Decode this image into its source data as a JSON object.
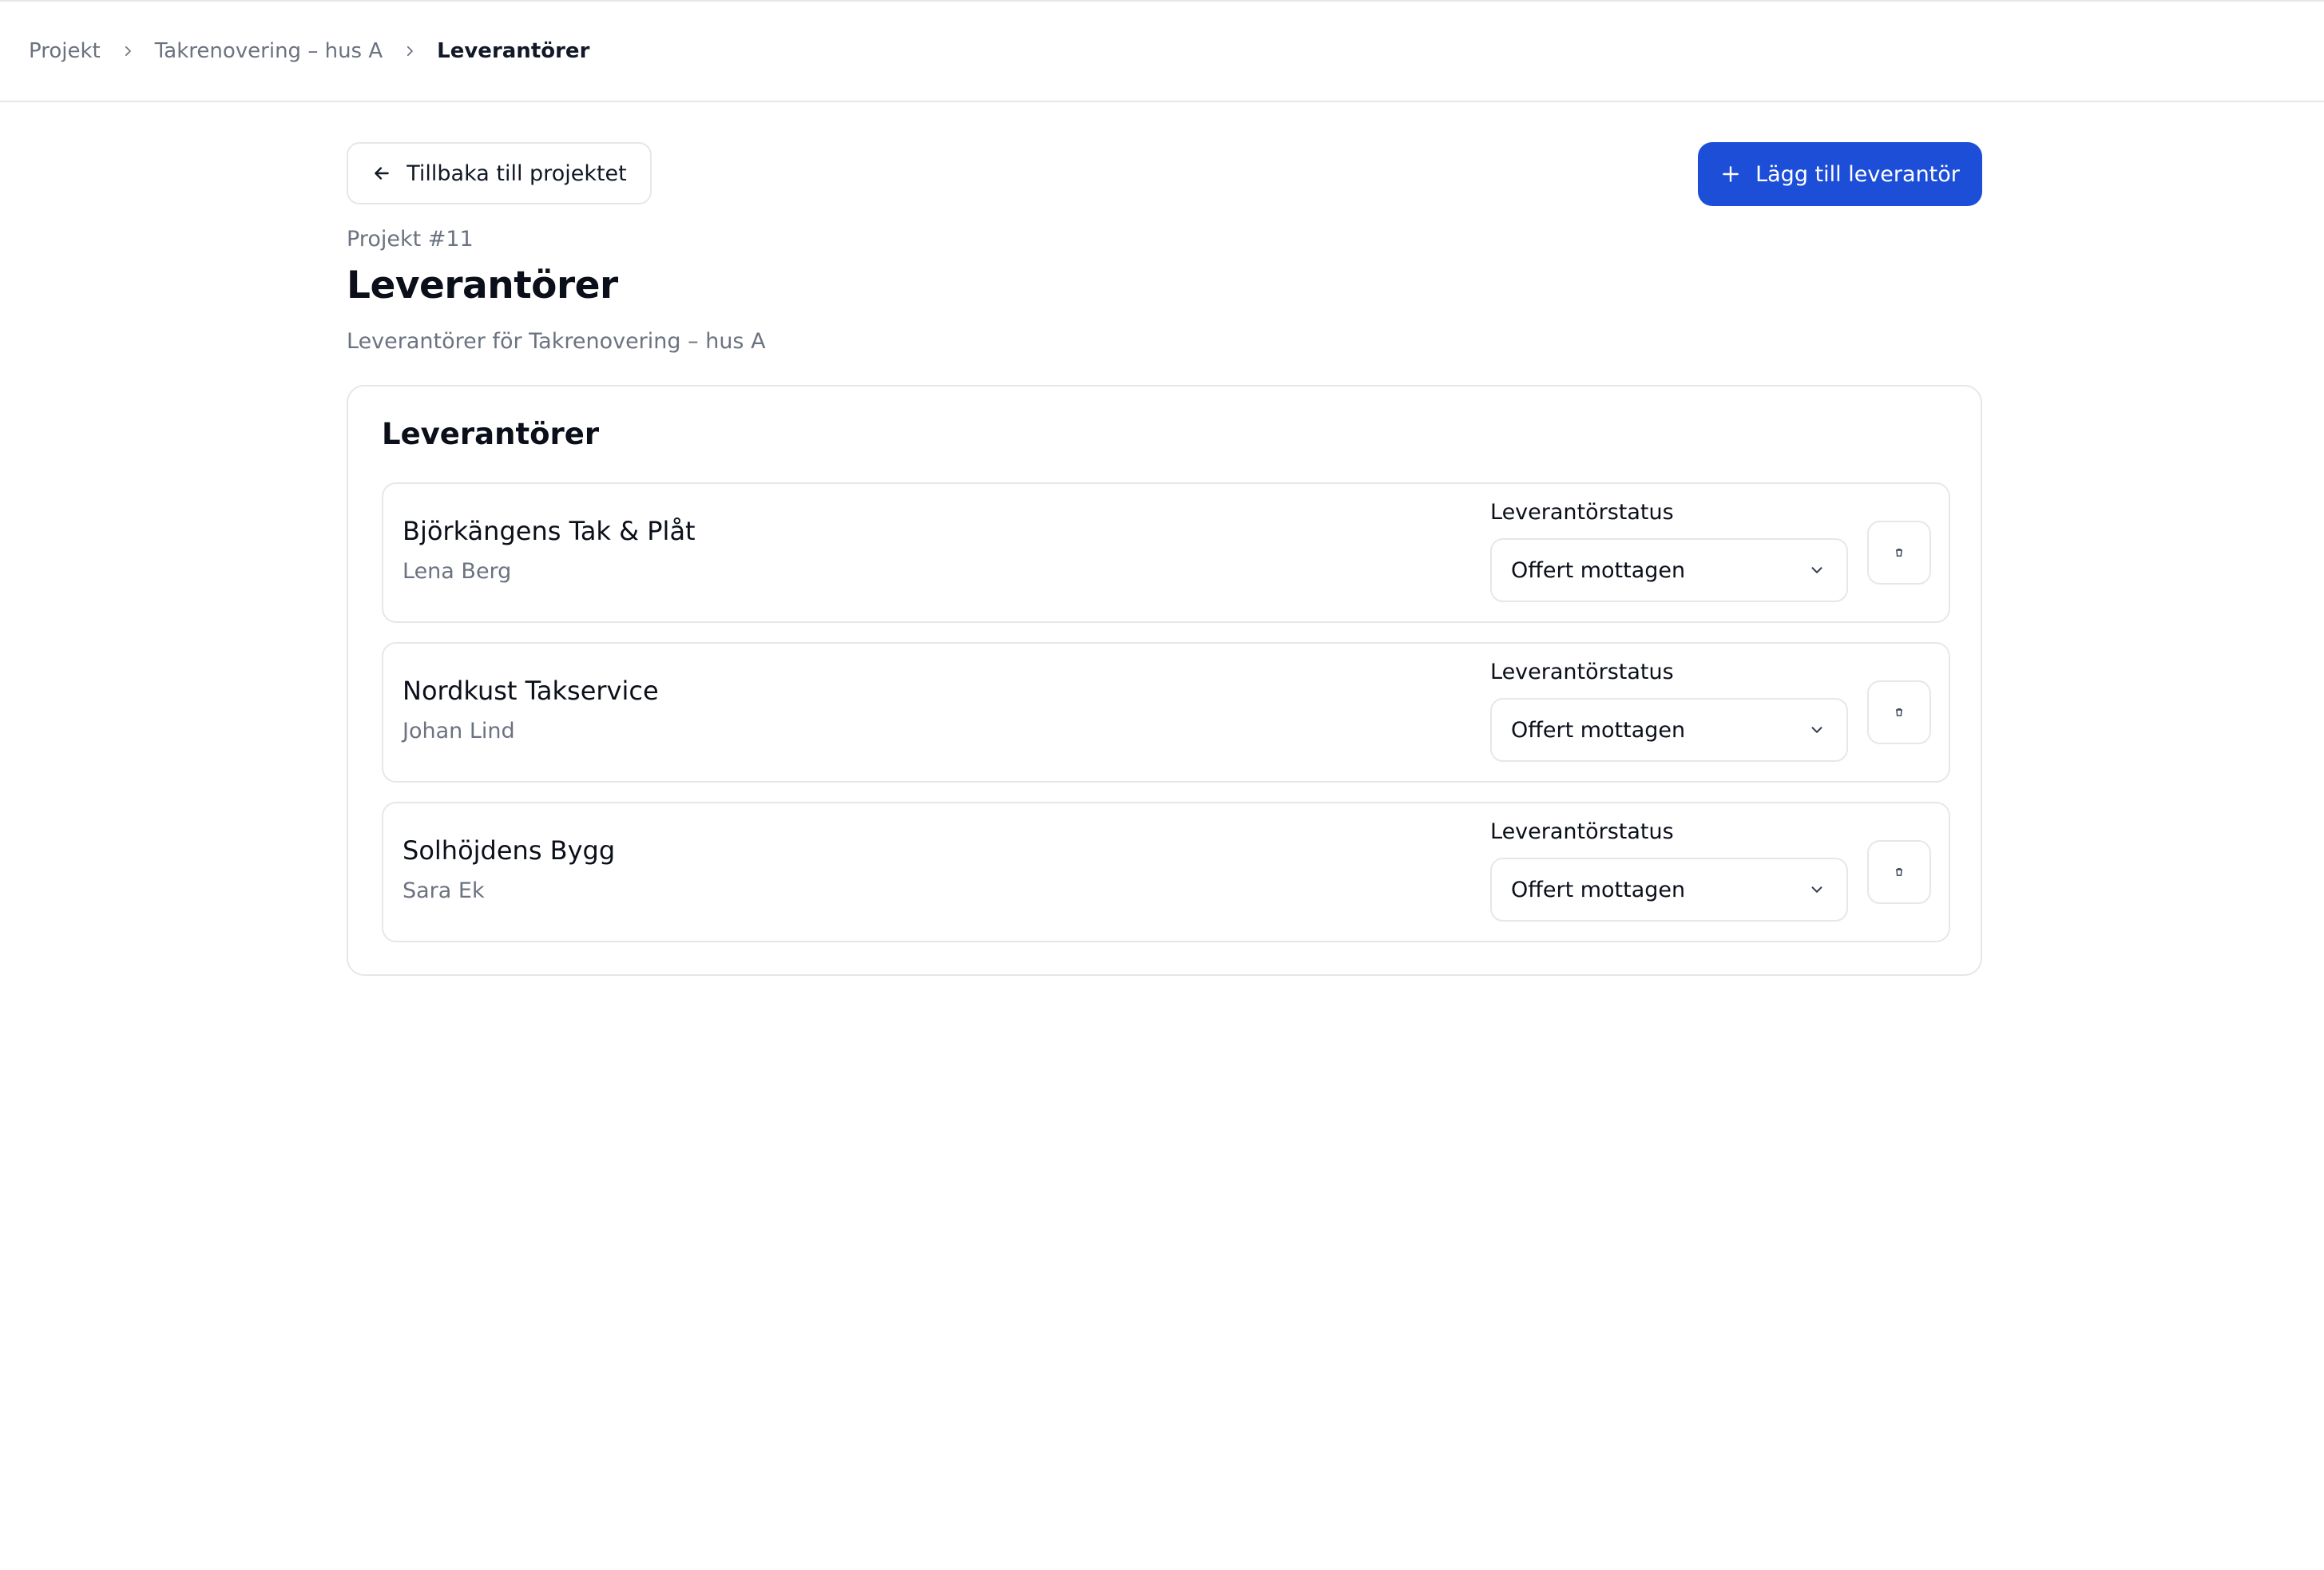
{
  "breadcrumb": {
    "items": [
      "Projekt",
      "Takrenovering – hus A",
      "Leverantörer"
    ]
  },
  "toolbar": {
    "back_label": "Tillbaka till projektet",
    "add_label": "Lägg till leverantör"
  },
  "header": {
    "project_number": "Projekt #11",
    "title": "Leverantörer",
    "subtitle": "Leverantörer för Takrenovering – hus A"
  },
  "card": {
    "title": "Leverantörer",
    "suppliers": [
      {
        "name": "Björkängens Tak & Plåt",
        "contact": "Lena Berg",
        "status_label": "Leverantörstatus",
        "status_value": "Offert mottagen"
      },
      {
        "name": "Nordkust Takservice",
        "contact": "Johan Lind",
        "status_label": "Leverantörstatus",
        "status_value": "Offert mottagen"
      },
      {
        "name": "Solhöjdens Bygg",
        "contact": "Sara Ek",
        "status_label": "Leverantörstatus",
        "status_value": "Offert mottagen"
      }
    ]
  },
  "colors": {
    "accent": "#1d4ed8",
    "border": "#e5e7eb",
    "muted_text": "#6b7280"
  },
  "icons": {
    "breadcrumb_separator": "chevron-right-icon",
    "back": "arrow-left-icon",
    "add": "plus-icon",
    "select": "chevron-down-icon",
    "delete": "trash-icon"
  }
}
